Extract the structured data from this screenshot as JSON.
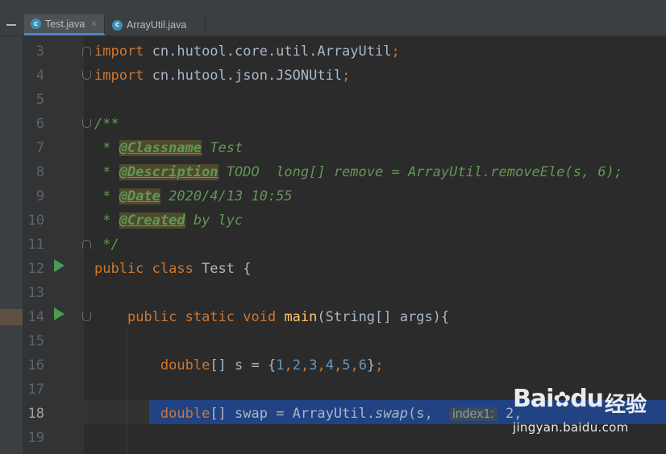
{
  "tabs": [
    {
      "name": "Test.java",
      "icon": "java-class-icon",
      "active": true,
      "close": "×"
    },
    {
      "name": "ArrayUtil.java",
      "icon": "java-class-icon",
      "active": false,
      "close": ""
    }
  ],
  "tab_icon_letter": "c",
  "lines": [
    {
      "n": "3",
      "tokens": [
        [
          "kw",
          "import"
        ],
        [
          "p",
          " cn.hutool.core.util.ArrayUtil"
        ],
        [
          "kw",
          ";"
        ]
      ]
    },
    {
      "n": "4",
      "tokens": [
        [
          "kw",
          "import"
        ],
        [
          "p",
          " cn.hutool.json.JSONUtil"
        ],
        [
          "kw",
          ";"
        ]
      ]
    },
    {
      "n": "5",
      "tokens": []
    },
    {
      "n": "6",
      "tokens": [
        [
          "doc",
          "/**"
        ]
      ]
    },
    {
      "n": "7",
      "tokens": [
        [
          "doc",
          " * "
        ],
        [
          "tag",
          "@Classname"
        ],
        [
          "doc",
          " Test"
        ]
      ]
    },
    {
      "n": "8",
      "tokens": [
        [
          "doc",
          " * "
        ],
        [
          "tag",
          "@Description"
        ],
        [
          "doc",
          " TODO  long[] remove = ArrayUtil.removeEle(s, 6);"
        ]
      ]
    },
    {
      "n": "9",
      "tokens": [
        [
          "doc",
          " * "
        ],
        [
          "tag",
          "@Date"
        ],
        [
          "doc",
          " 2020/4/13 10:55"
        ]
      ]
    },
    {
      "n": "10",
      "tokens": [
        [
          "doc",
          " * "
        ],
        [
          "tag",
          "@Created"
        ],
        [
          "doc",
          " by lyc"
        ]
      ]
    },
    {
      "n": "11",
      "tokens": [
        [
          "doc",
          " */"
        ]
      ]
    },
    {
      "n": "12",
      "tokens": [
        [
          "kw",
          "public class"
        ],
        [
          "p",
          " Test {"
        ]
      ]
    },
    {
      "n": "13",
      "tokens": []
    },
    {
      "n": "14",
      "tokens": [
        [
          "p",
          "    "
        ],
        [
          "kw",
          "public static void"
        ],
        [
          "p",
          " "
        ],
        [
          "fn",
          "main"
        ],
        [
          "p",
          "(String[] args){"
        ]
      ]
    },
    {
      "n": "15",
      "tokens": []
    },
    {
      "n": "16",
      "tokens": [
        [
          "p",
          "        "
        ],
        [
          "kw",
          "double"
        ],
        [
          "p",
          "[] s = {"
        ],
        [
          "num",
          "1"
        ],
        [
          "kw",
          ","
        ],
        [
          "num",
          "2"
        ],
        [
          "kw",
          ","
        ],
        [
          "num",
          "3"
        ],
        [
          "kw",
          ","
        ],
        [
          "num",
          "4"
        ],
        [
          "kw",
          ","
        ],
        [
          "num",
          "5"
        ],
        [
          "kw",
          ","
        ],
        [
          "num",
          "6"
        ],
        [
          "p",
          "}"
        ],
        [
          "kw",
          ";"
        ]
      ]
    },
    {
      "n": "17",
      "tokens": []
    },
    {
      "n": "18",
      "tokens": [
        [
          "p",
          "        "
        ],
        [
          "kw",
          "double"
        ],
        [
          "p",
          "[] swap = ArrayUtil."
        ],
        [
          "italic",
          "swap"
        ],
        [
          "p",
          "(s,  "
        ],
        [
          "hint",
          "index1:"
        ],
        [
          "p",
          " 2,"
        ]
      ]
    },
    {
      "n": "19",
      "tokens": []
    }
  ],
  "current_line": "18",
  "watermark": {
    "brand": "Bai",
    "brand_du": "du",
    "cn": "经验",
    "url": "jingyan.baidu.com"
  }
}
